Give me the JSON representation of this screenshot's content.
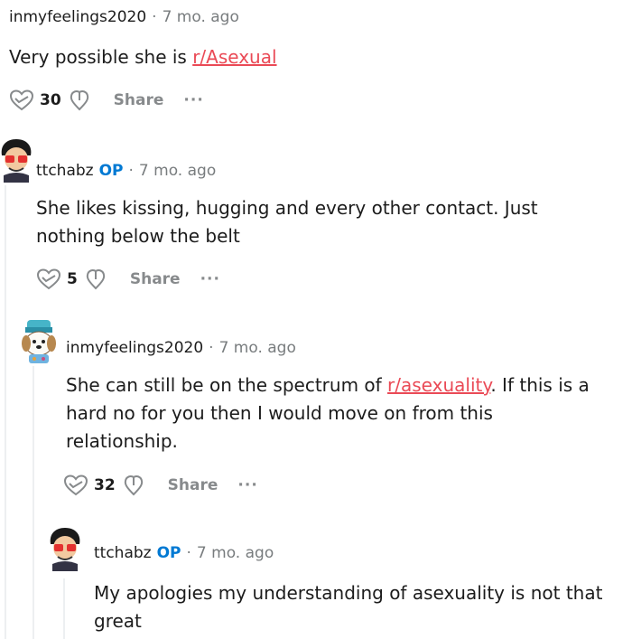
{
  "comments": [
    {
      "username": "inmyfeelings2020",
      "op": "",
      "separator": "·",
      "time": "7 mo. ago",
      "text_before": "Very possible she is ",
      "link": "r/Asexual",
      "text_after": "",
      "votes": "30",
      "share_label": "Share",
      "more_label": "···"
    },
    {
      "username": "ttchabz",
      "op": "OP",
      "separator": "·",
      "time": "7 mo. ago",
      "text_before": "She likes kissing, hugging and every other contact. Just nothing below the belt",
      "link": "",
      "text_after": "",
      "votes": "5",
      "share_label": "Share",
      "more_label": "···"
    },
    {
      "username": "inmyfeelings2020",
      "op": "",
      "separator": "·",
      "time": "7 mo. ago",
      "text_before": "She can still be on the spectrum of ",
      "link": "r/asexuality",
      "text_after": ". If this is a hard no for you then I would move on from this relationship.",
      "votes": "32",
      "share_label": "Share",
      "more_label": "···"
    },
    {
      "username": "ttchabz",
      "op": "OP",
      "separator": "·",
      "time": "7 mo. ago",
      "text_before": "My apologies my understanding of asexuality is not that great",
      "link": "",
      "text_after": "",
      "votes": "",
      "share_label": "",
      "more_label": ""
    }
  ],
  "colors": {
    "op_blue": "#0079d3",
    "link_red": "#ea4a56",
    "meta_gray": "#787c7e",
    "thread_line": "#edeff1"
  },
  "icons": [
    "upvote-heart-icon",
    "downvote-heart-icon",
    "more-dots-icon",
    "avatar-icon"
  ]
}
